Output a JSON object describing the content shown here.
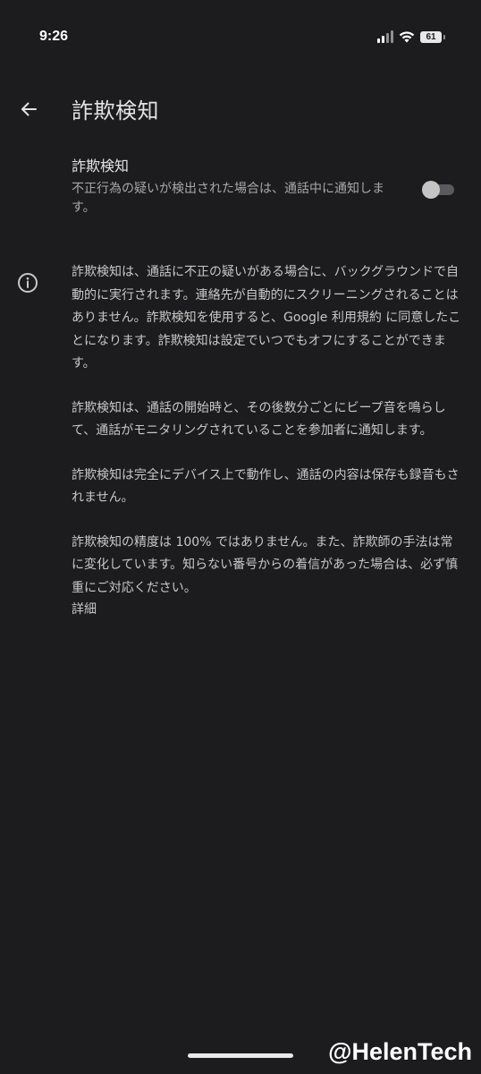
{
  "status_bar": {
    "time": "9:26",
    "battery": "61",
    "icons": [
      "signal-icon",
      "wifi-icon",
      "battery-icon"
    ]
  },
  "app_bar": {
    "back_icon": "arrow-back-icon",
    "title": "詐欺検知"
  },
  "setting": {
    "title": "詐欺検知",
    "description": "不正行為の疑いが検出された場合は、通話中に通知します。",
    "toggle_on": false
  },
  "info": {
    "icon": "info-icon",
    "para1_before": "詐欺検知は、通話に不正の疑いがある場合に、バックグラウンドで自動的に実行されます。連絡先が自動的にスクリーニングされることはありません。詐欺検知を使用すると、",
    "para1_link": "Google 利用規約",
    "para1_after": " に同意したことになります。詐欺検知は設定でいつでもオフにすることができます。",
    "para2": "詐欺検知は、通話の開始時と、その後数分ごとにビープ音を鳴らして、通話がモニタリングされていることを参加者に通知します。",
    "para3": "詐欺検知は完全にデバイス上で動作し、通話の内容は保存も録音もされません。",
    "para4": "詐欺検知の精度は 100% ではありません。また、詐欺師の手法は常に変化しています。知らない番号からの着信があった場合は、必ず慎重にご対応ください。",
    "detail_link": "詳細"
  },
  "watermark": "@HelenTech",
  "colors": {
    "background": "#1c1c1e",
    "text_primary": "#e3e3e3",
    "text_secondary": "#a8a8a8"
  }
}
